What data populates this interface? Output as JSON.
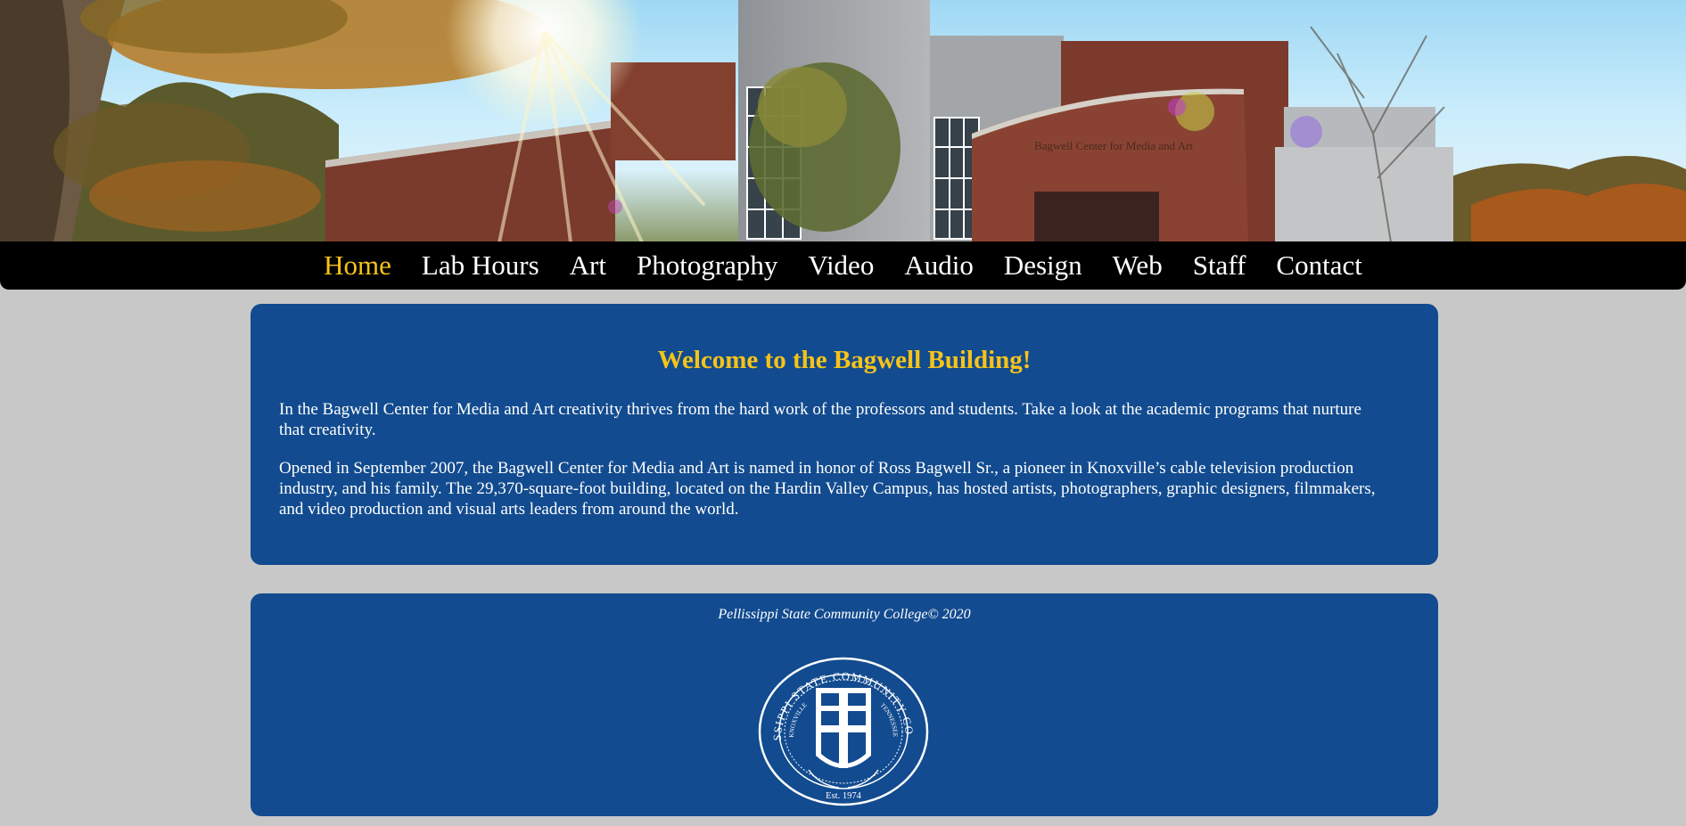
{
  "hero": {
    "building_sign": "Bagwell Center for Media and Art"
  },
  "nav": {
    "items": [
      {
        "label": "Home",
        "active": true
      },
      {
        "label": "Lab Hours",
        "active": false
      },
      {
        "label": "Art",
        "active": false
      },
      {
        "label": "Photography",
        "active": false
      },
      {
        "label": "Video",
        "active": false
      },
      {
        "label": "Audio",
        "active": false
      },
      {
        "label": "Design",
        "active": false
      },
      {
        "label": "Web",
        "active": false
      },
      {
        "label": "Staff",
        "active": false
      },
      {
        "label": "Contact",
        "active": false
      }
    ]
  },
  "welcome": {
    "title": "Welcome to the Bagwell Building!",
    "paragraph1": "In the Bagwell Center for Media and Art creativity thrives from the hard work of the professors and students. Take a look at the academic programs that nurture that creativity.",
    "paragraph2": "Opened in September 2007, the Bagwell Center for Media and Art is named in honor of Ross Bagwell Sr., a pioneer in Knoxville’s cable television production industry, and his family. The 29,370-square-foot building, located on the Hardin Valley Campus, has hosted artists, photographers, graphic designers, filmmakers, and video production and visual arts leaders from around the world."
  },
  "footer": {
    "copyright": "Pellissippi State Community College© 2020",
    "seal": {
      "ring_text": "PELLISSIPPI STATE COMMUNITY COLLEGE",
      "inner_left": "KNOXVILLE",
      "inner_right": "TENNESSEE",
      "established": "Est. 1974"
    }
  },
  "colors": {
    "accent": "#f6c319",
    "panel": "#124b8f",
    "nav_bg": "#000000",
    "page_bg": "#c8c8c8"
  }
}
